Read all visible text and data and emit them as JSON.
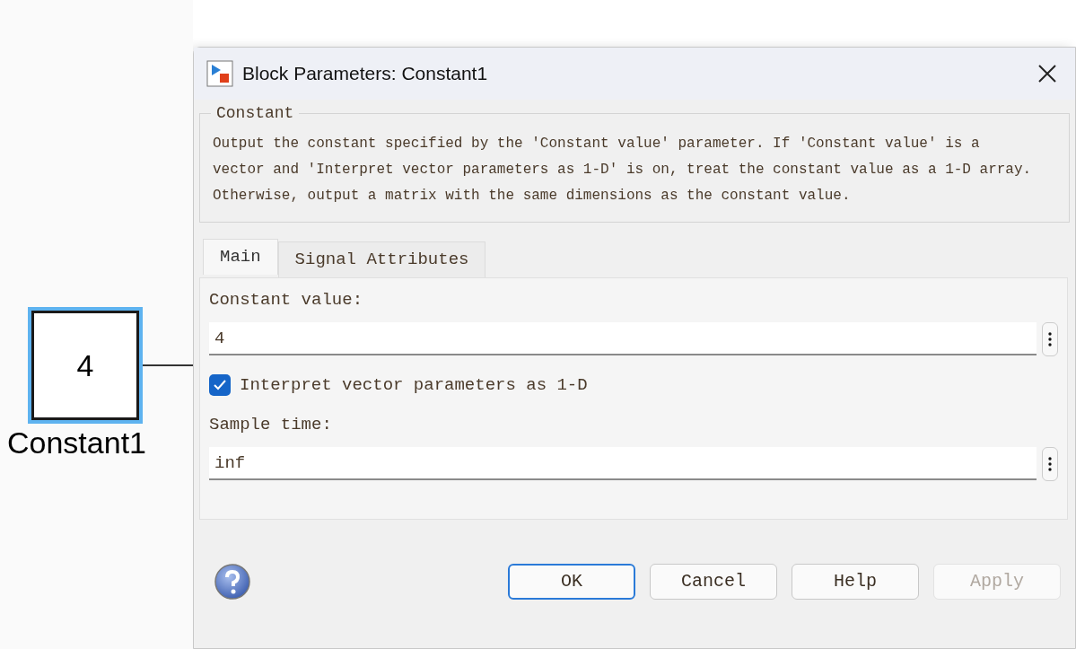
{
  "canvas": {
    "block": {
      "value": "4",
      "name": "Constant1",
      "selected": true
    }
  },
  "window": {
    "title": "Block Parameters: Constant1"
  },
  "group": {
    "title": "Constant",
    "description": "Output the constant specified by the 'Constant value' parameter. If 'Constant value' is a vector and 'Interpret vector parameters as 1-D' is on, treat the constant value as a 1-D array. Otherwise, output a matrix with the same dimensions as the constant value."
  },
  "tabs": [
    {
      "label": "Main",
      "selected": true
    },
    {
      "label": "Signal Attributes",
      "selected": false
    }
  ],
  "fields": [
    {
      "kind": "text",
      "label": "Constant value:",
      "value": "4"
    },
    {
      "kind": "checkbox",
      "label": "Interpret vector parameters as 1-D",
      "checked": true
    },
    {
      "kind": "text",
      "label": "Sample time:",
      "value": "inf"
    }
  ],
  "buttons": [
    {
      "label": "OK",
      "default": true,
      "disabled": false
    },
    {
      "label": "Cancel",
      "default": false,
      "disabled": false
    },
    {
      "label": "Help",
      "default": false,
      "disabled": false
    },
    {
      "label": "Apply",
      "default": false,
      "disabled": true
    }
  ]
}
